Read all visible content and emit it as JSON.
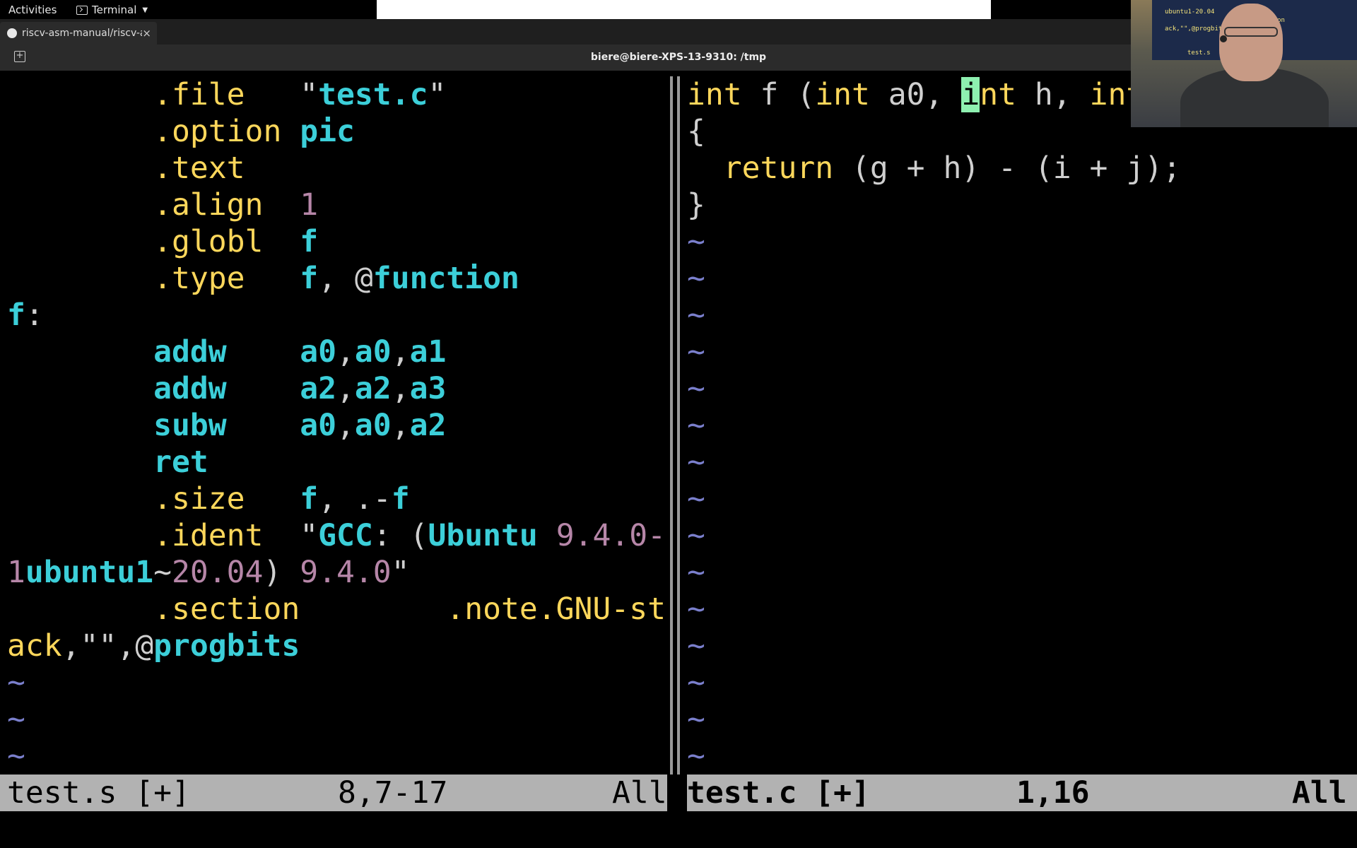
{
  "topbar": {
    "activities": "Activities",
    "app_menu": "Terminal"
  },
  "tabbar": {
    "tab_title": "riscv-asm-manual/riscv-asm.md",
    "close": "×",
    "new_tab": "+"
  },
  "titlebar": {
    "title": "biere@biere-XPS-13-9310: /tmp"
  },
  "left_pane": {
    "lines": [
      [
        [
          "        ",
          "g"
        ],
        [
          ".file",
          "y"
        ],
        [
          "   ",
          "g"
        ],
        [
          "\"",
          "g"
        ],
        [
          "test.c",
          "c"
        ],
        [
          "\"",
          "g"
        ]
      ],
      [
        [
          "        ",
          "g"
        ],
        [
          ".option",
          "y"
        ],
        [
          " ",
          "g"
        ],
        [
          "pic",
          "c"
        ]
      ],
      [
        [
          "        ",
          "g"
        ],
        [
          ".text",
          "y"
        ]
      ],
      [
        [
          "        ",
          "g"
        ],
        [
          ".align",
          "y"
        ],
        [
          "  ",
          "g"
        ],
        [
          "1",
          "m"
        ]
      ],
      [
        [
          "        ",
          "g"
        ],
        [
          ".globl",
          "y"
        ],
        [
          "  ",
          "g"
        ],
        [
          "f",
          "c"
        ]
      ],
      [
        [
          "        ",
          "g"
        ],
        [
          ".type",
          "y"
        ],
        [
          "   ",
          "g"
        ],
        [
          "f",
          "c"
        ],
        [
          ", ",
          "g"
        ],
        [
          "@",
          "g"
        ],
        [
          "function",
          "c"
        ]
      ],
      [
        [
          "f",
          "c"
        ],
        [
          ":",
          "g"
        ]
      ],
      [
        [
          "        ",
          "g"
        ],
        [
          "addw",
          "c"
        ],
        [
          "    ",
          "g"
        ],
        [
          "a0",
          "c"
        ],
        [
          ",",
          "g"
        ],
        [
          "a0",
          "c"
        ],
        [
          ",",
          "g"
        ],
        [
          "a1",
          "c"
        ]
      ],
      [
        [
          "        ",
          "g"
        ],
        [
          "addw",
          "c"
        ],
        [
          "    ",
          "g"
        ],
        [
          "a2",
          "c"
        ],
        [
          ",",
          "g"
        ],
        [
          "a2",
          "c"
        ],
        [
          ",",
          "g"
        ],
        [
          "a3",
          "c"
        ]
      ],
      [
        [
          "        ",
          "g"
        ],
        [
          "subw",
          "c"
        ],
        [
          "    ",
          "g"
        ],
        [
          "a0",
          "c"
        ],
        [
          ",",
          "g"
        ],
        [
          "a0",
          "c"
        ],
        [
          ",",
          "g"
        ],
        [
          "a2",
          "c"
        ]
      ],
      [
        [
          "        ",
          "g"
        ],
        [
          "ret",
          "c"
        ]
      ],
      [
        [
          "        ",
          "g"
        ],
        [
          ".size",
          "y"
        ],
        [
          "   ",
          "g"
        ],
        [
          "f",
          "c"
        ],
        [
          ", .-",
          "g"
        ],
        [
          "f",
          "c"
        ]
      ],
      [
        [
          "        ",
          "g"
        ],
        [
          ".ident",
          "y"
        ],
        [
          "  ",
          "g"
        ],
        [
          "\"",
          "g"
        ],
        [
          "GCC",
          "c"
        ],
        [
          ": (",
          "g"
        ],
        [
          "Ubuntu",
          "c"
        ],
        [
          " ",
          "g"
        ],
        [
          "9.4.0-",
          "m"
        ]
      ],
      [
        [
          "1",
          "m"
        ],
        [
          "ubuntu1",
          "c"
        ],
        [
          "~",
          "g"
        ],
        [
          "20.04",
          "m"
        ],
        [
          ") ",
          "g"
        ],
        [
          "9.4.0",
          "m"
        ],
        [
          "\"",
          "g"
        ]
      ],
      [
        [
          "        ",
          "g"
        ],
        [
          ".section",
          "y"
        ],
        [
          "        ",
          "g"
        ],
        [
          ".note.GNU-st",
          "y"
        ]
      ],
      [
        [
          "ack",
          "y"
        ],
        [
          ",\"\",",
          "g"
        ],
        [
          "@",
          "g"
        ],
        [
          "progbits",
          "c"
        ]
      ],
      [
        [
          "~",
          "t"
        ]
      ],
      [
        [
          "~",
          "t"
        ]
      ],
      [
        [
          "~",
          "t"
        ]
      ]
    ]
  },
  "right_pane": {
    "lines": [
      [
        [
          "int",
          "y"
        ],
        [
          " f (",
          "g"
        ],
        [
          "int",
          "y"
        ],
        [
          " a0, ",
          "g"
        ],
        [
          "i",
          "cur"
        ],
        [
          "nt",
          "y"
        ],
        [
          " h, ",
          "g"
        ],
        [
          "int",
          "y"
        ]
      ],
      [
        [
          "{",
          "g"
        ]
      ],
      [
        [
          "  ",
          "g"
        ],
        [
          "return",
          "y"
        ],
        [
          " (g + h) - (i + j);",
          "g"
        ]
      ],
      [
        [
          "}",
          "g"
        ]
      ],
      [
        [
          "~",
          "t"
        ]
      ],
      [
        [
          "~",
          "t"
        ]
      ],
      [
        [
          "~",
          "t"
        ]
      ],
      [
        [
          "~",
          "t"
        ]
      ],
      [
        [
          "~",
          "t"
        ]
      ],
      [
        [
          "~",
          "t"
        ]
      ],
      [
        [
          "~",
          "t"
        ]
      ],
      [
        [
          "~",
          "t"
        ]
      ],
      [
        [
          "~",
          "t"
        ]
      ],
      [
        [
          "~",
          "t"
        ]
      ],
      [
        [
          "~",
          "t"
        ]
      ],
      [
        [
          "~",
          "t"
        ]
      ],
      [
        [
          "~",
          "t"
        ]
      ],
      [
        [
          "~",
          "t"
        ]
      ],
      [
        [
          "~",
          "t"
        ]
      ]
    ]
  },
  "status_left": {
    "file": "test.s [+]",
    "position": "8,7-17",
    "scroll": "All"
  },
  "status_right": {
    "file": "test.c [+]",
    "position": "1,16",
    "scroll": "All"
  },
  "webcam": {
    "lines": [
      "ubuntu1-20.04",
      "section",
      "ack,\"\",@progbits",
      "test.s"
    ]
  }
}
